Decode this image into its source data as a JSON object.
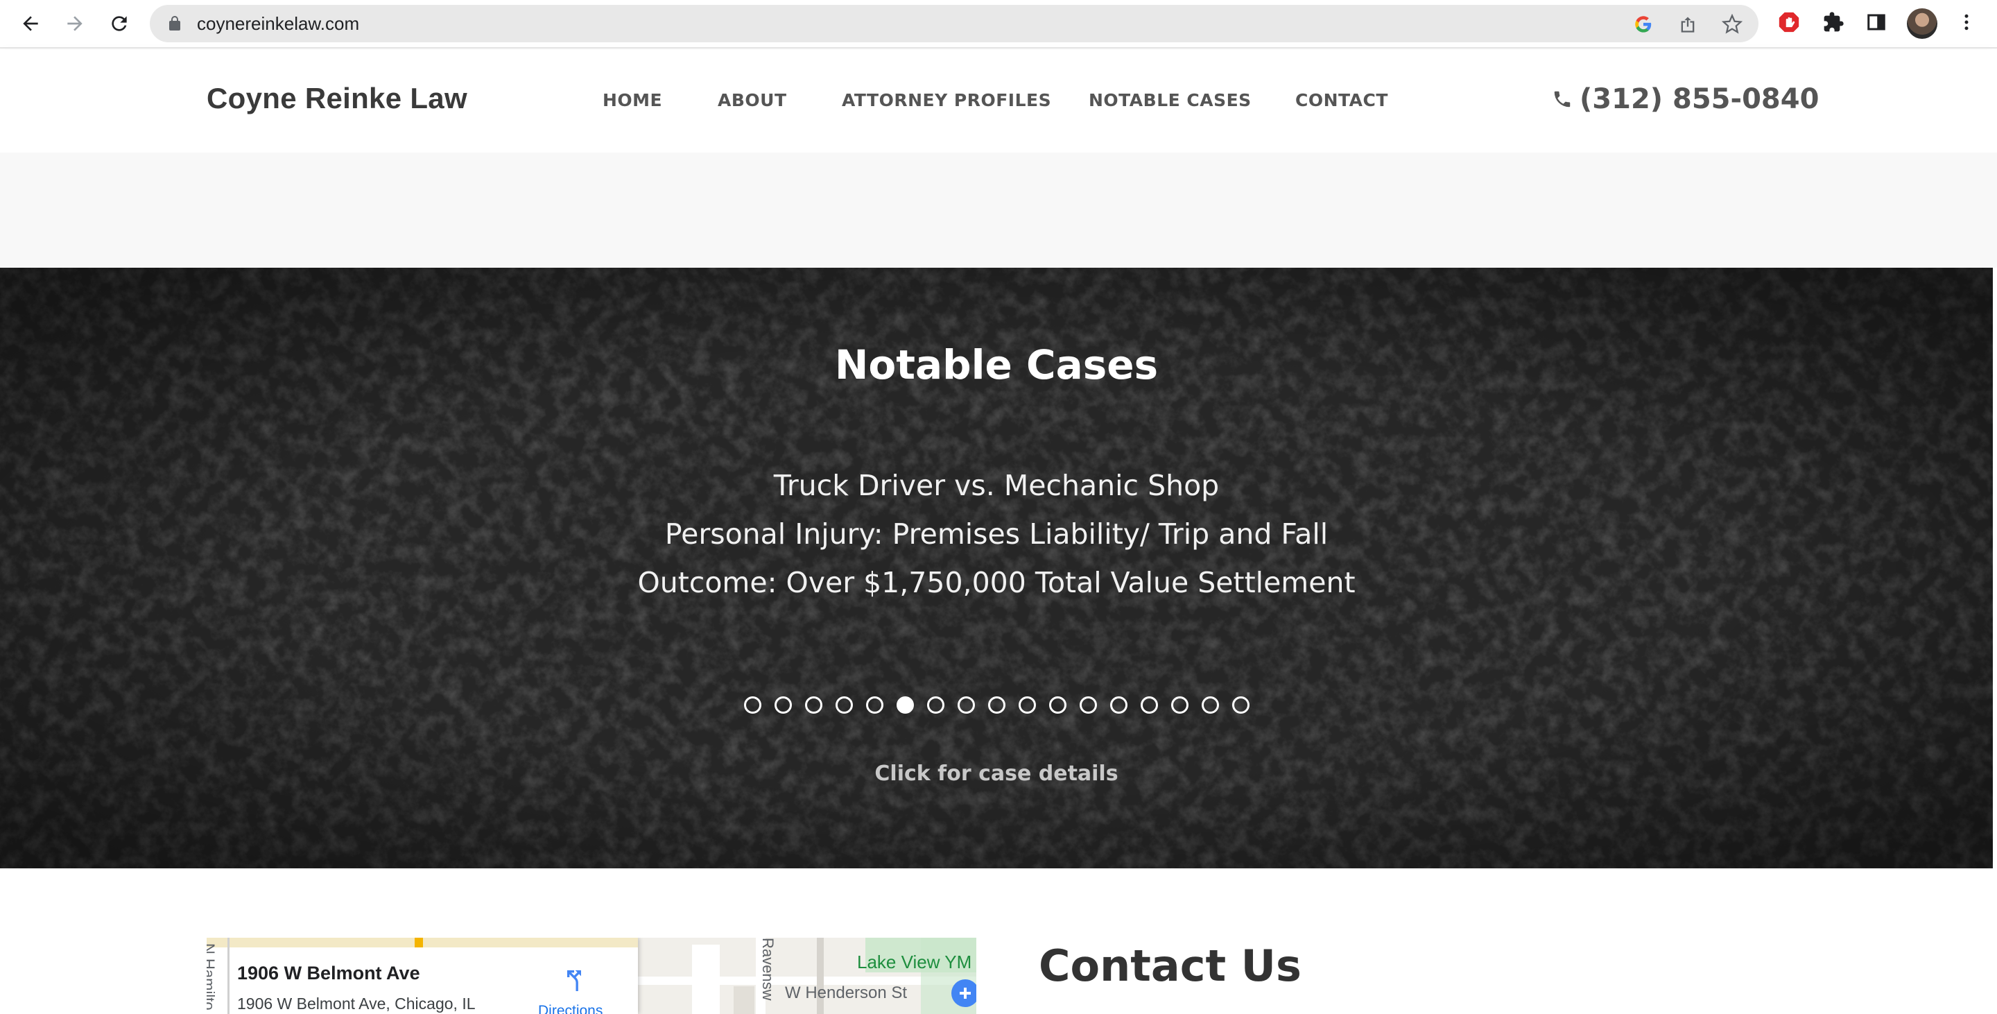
{
  "browser": {
    "url": "coynereinkelaw.com"
  },
  "header": {
    "brand": "Coyne Reinke Law",
    "nav": [
      {
        "label": "HOME"
      },
      {
        "label": "ABOUT"
      },
      {
        "label": "ATTORNEY PROFILES"
      },
      {
        "label": "NOTABLE CASES"
      },
      {
        "label": "CONTACT"
      }
    ],
    "phone": "(312) 855-0840"
  },
  "hero": {
    "title": "Notable Cases",
    "case_lines": [
      "Truck Driver vs. Mechanic Shop",
      "Personal Injury: Premises Liability/ Trip and Fall",
      "Outcome: Over $1,750,000 Total Value Settlement"
    ],
    "slide_count": 17,
    "active_slide": 6,
    "cta": "Click for case details"
  },
  "map": {
    "place_title": "1906 W Belmont Ave",
    "place_address": "1906 W Belmont Ave, Chicago, IL",
    "directions_label": "Directions",
    "street_henderson": "W Henderson St",
    "park_label": "Lake View YM",
    "street_ravenswood": "Ravensw",
    "street_hamilton": "N Hamilto"
  },
  "contact": {
    "title": "Contact Us"
  },
  "colors": {
    "hero_bg": "#1c1c1c",
    "text_dark": "#333333",
    "menu_text": "#555555"
  }
}
